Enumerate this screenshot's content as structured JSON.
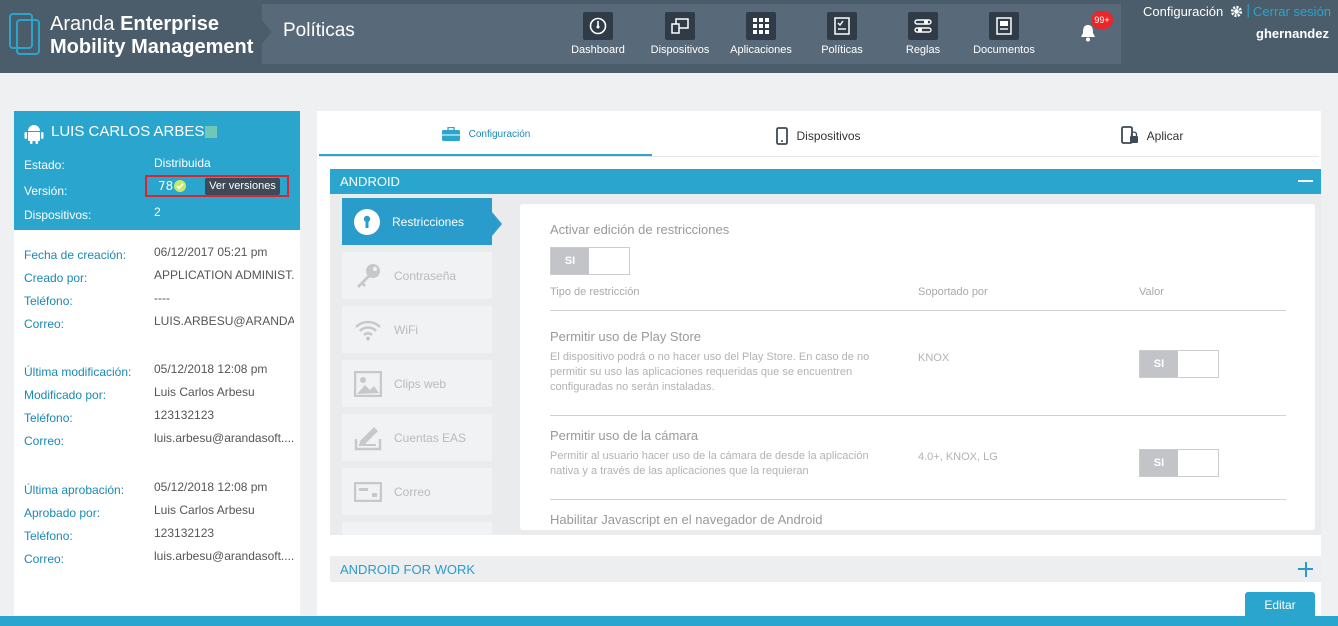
{
  "header": {
    "brand_light": "Aranda",
    "brand_bold": "Enterprise",
    "brand_line2": "Mobility Management",
    "page_title": "Políticas",
    "nav": [
      {
        "label": "Dashboard",
        "icon": "dashboard-icon"
      },
      {
        "label": "Dispositivos",
        "icon": "devices-icon"
      },
      {
        "label": "Aplicaciones",
        "icon": "apps-grid-icon"
      },
      {
        "label": "Políticas",
        "icon": "policy-checklist-icon"
      },
      {
        "label": "Reglas",
        "icon": "rules-sliders-icon"
      },
      {
        "label": "Documentos",
        "icon": "documents-icon"
      }
    ],
    "notifications_badge": "99+",
    "config_label": "Configuración",
    "separator": "|",
    "logout_label": "Cerrar sesión",
    "username": "ghernandez"
  },
  "user": {
    "name": "LUIS CARLOS ARBESU",
    "estado_label": "Estado:",
    "estado_value": "Distribuida",
    "version_label": "Versión:",
    "version_value": "78",
    "versions_button": "Ver versiones",
    "devices_label": "Dispositivos:",
    "devices_value": "2"
  },
  "info": [
    {
      "label": "Fecha de creación:",
      "value": "06/12/2017 05:21 pm"
    },
    {
      "label": "Creado por:",
      "value": "APPLICATION ADMINIST..."
    },
    {
      "label": "Teléfono:",
      "value": "----"
    },
    {
      "label": "Correo:",
      "value": "LUIS.ARBESU@ARANDA..."
    },
    {
      "label": "Última modificación:",
      "value": "05/12/2018 12:08 pm"
    },
    {
      "label": "Modificado por:",
      "value": "Luis Carlos Arbesu"
    },
    {
      "label": "Teléfono:",
      "value": "123132123"
    },
    {
      "label": "Correo:",
      "value": "luis.arbesu@arandasoft...."
    },
    {
      "label": "Última aprobación:",
      "value": "05/12/2018 12:08 pm"
    },
    {
      "label": "Aprobado por:",
      "value": "Luis Carlos Arbesu"
    },
    {
      "label": "Teléfono:",
      "value": "123132123"
    },
    {
      "label": "Correo:",
      "value": "luis.arbesu@arandasoft...."
    }
  ],
  "tabs": [
    {
      "label": "Configuración",
      "icon": "briefcase-icon"
    },
    {
      "label": "Dispositivos",
      "icon": "phone-icon"
    },
    {
      "label": "Aplicar",
      "icon": "phone-lock-icon"
    }
  ],
  "section_android": "ANDROID",
  "side_menu": [
    {
      "label": "Restricciones",
      "icon": "keyhole-icon"
    },
    {
      "label": "Contraseña",
      "icon": "key-icon"
    },
    {
      "label": "WiFi",
      "icon": "wifi-icon"
    },
    {
      "label": "Clips web",
      "icon": "image-icon"
    },
    {
      "label": "Cuentas EAS",
      "icon": "signature-icon"
    },
    {
      "label": "Correo",
      "icon": "mail-card-icon"
    }
  ],
  "restrictions": {
    "title": "Activar edición de restricciones",
    "toggle": "SI",
    "col_type": "Tipo de restricción",
    "col_supported": "Soportado por",
    "col_value": "Valor",
    "rows": [
      {
        "title": "Permitir uso de Play Store",
        "desc": "El dispositivo podrá o no hacer uso del Play Store. En caso de no permitir su uso las aplicaciones requeridas que se encuentren configuradas no serán instaladas.",
        "supported": "KNOX",
        "value": "SI"
      },
      {
        "title": "Permitir uso de la cámara",
        "desc": "Permitir al usuario hacer uso de la cámara de desde la aplicación nativa y a través de las aplicaciones que la requieran",
        "supported": "4.0+, KNOX, LG",
        "value": "SI"
      },
      {
        "title": "Habilitar Javascript en el navegador de Android",
        "desc": "",
        "supported": "",
        "value": ""
      }
    ]
  },
  "section_android_work": "ANDROID FOR WORK",
  "edit_button": "Editar",
  "colors": {
    "accent": "#29a5ce",
    "header": "#4b5c6b",
    "danger": "#e8262b"
  }
}
